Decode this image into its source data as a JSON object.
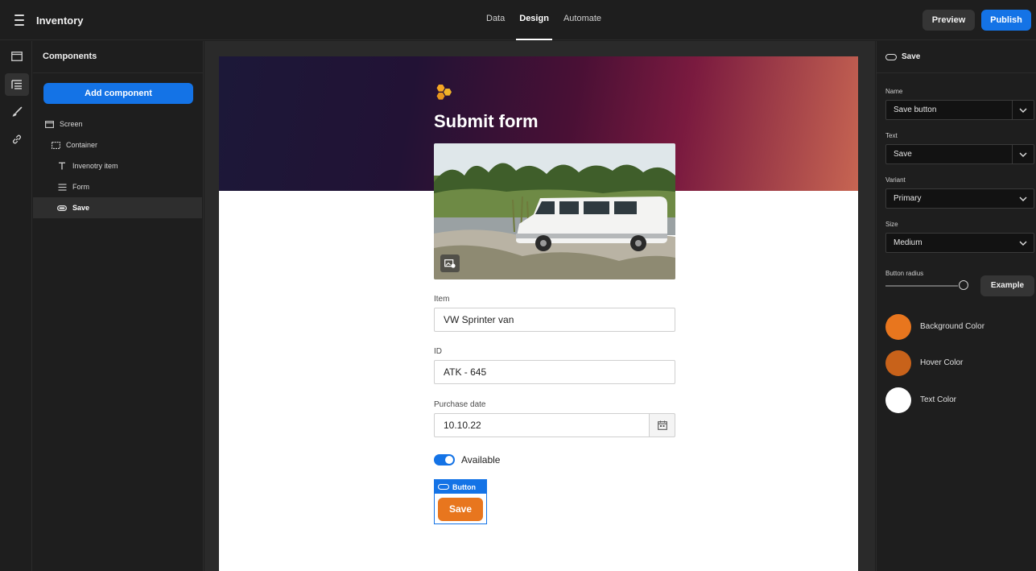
{
  "app": {
    "title": "Inventory"
  },
  "tabs": [
    {
      "label": "Data",
      "active": false
    },
    {
      "label": "Design",
      "active": true
    },
    {
      "label": "Automate",
      "active": false
    }
  ],
  "actions": {
    "preview": "Preview",
    "publish": "Publish"
  },
  "rail": [
    "layout-icon",
    "layers-icon",
    "brush-icon",
    "link-icon"
  ],
  "components": {
    "header": "Components",
    "add_label": "Add component",
    "tree": [
      {
        "label": "Screen",
        "icon": "screen-icon"
      },
      {
        "label": "Container",
        "icon": "container-icon"
      },
      {
        "label": "Invenotry item",
        "icon": "text-icon"
      },
      {
        "label": "Form",
        "icon": "form-icon"
      },
      {
        "label": "Save",
        "icon": "button-icon",
        "selected": true
      }
    ]
  },
  "preview": {
    "title": "Submit form",
    "fields": {
      "item_label": "Item",
      "item_value": "VW Sprinter van",
      "id_label": "ID",
      "id_value": "ATK - 645",
      "date_label": "Purchase date",
      "date_value": "10.10.22"
    },
    "toggle": {
      "label": "Available",
      "on": true
    },
    "selection_tag": "Button",
    "save_label": "Save"
  },
  "properties": {
    "header": "Save",
    "name_label": "Name",
    "name_value": "Save button",
    "text_label": "Text",
    "text_value": "Save",
    "variant_label": "Variant",
    "variant_value": "Primary",
    "size_label": "Size",
    "size_value": "Medium",
    "radius_label": "Button radius",
    "example_label": "Example",
    "colors": [
      {
        "label": "Background Color",
        "hex": "#e8761e"
      },
      {
        "label": "Hover Color",
        "hex": "#c8621a"
      },
      {
        "label": "Text Color",
        "hex": "#ffffff"
      }
    ]
  }
}
